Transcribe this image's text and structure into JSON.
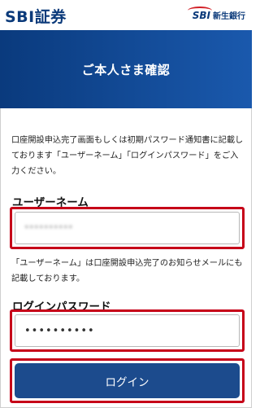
{
  "header": {
    "brand_left": "SBI証券",
    "brand_right_mark": "SBI",
    "brand_right_name": "新生銀行"
  },
  "banner": {
    "title": "ご本人さま確認"
  },
  "intro_text": "口座開設申込完了画面もしくは初期パスワード通知書に記載しております「ユーザーネーム」「ログインパスワード」をご入力ください。",
  "username": {
    "label": "ユーザーネーム",
    "value": "**********",
    "note": "「ユーザーネーム」は口座開設申込完了のお知らせメールにも記載しております。"
  },
  "password": {
    "label": "ログインパスワード",
    "value": "••••••••••"
  },
  "login_button": {
    "label": "ログイン"
  },
  "colors": {
    "brand_navy": "#0b3a7a",
    "button_blue": "#1c4b8d",
    "highlight_red": "#c60018"
  }
}
